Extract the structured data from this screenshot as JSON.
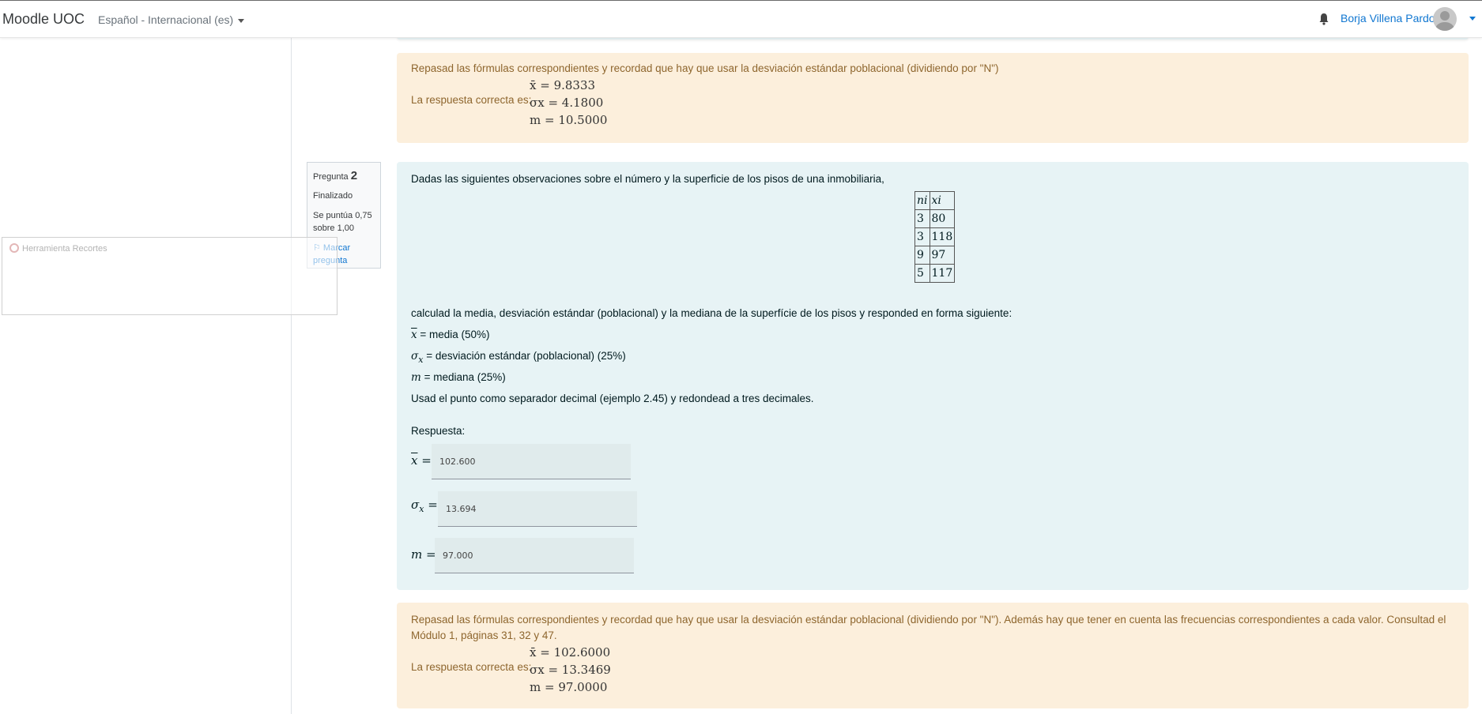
{
  "navbar": {
    "brand": "Moodle UOC",
    "language": "Español - Internacional (es)",
    "notifications_icon": "bell-icon",
    "username": "Borja Villena Pardo",
    "avatar_icon": "user-avatar-icon"
  },
  "snipping_tool": {
    "title": "Herramienta Recortes"
  },
  "feedback_prev": {
    "text": "Repasad las fórmulas correspondientes y recordad que hay que usar la desviación estándar poblacional (dividiendo por \"N\")",
    "correct_label": "La respuesta correcta es:",
    "mean": "x̄ = 9.8333",
    "sd": "σx = 4.1800",
    "median": "m = 10.5000"
  },
  "question_info": {
    "label": "Pregunta",
    "number": "2",
    "state": "Finalizado",
    "grade": "Se puntúa 0,75 sobre 1,00",
    "flag": "Marcar pregunta",
    "flag_icon": "flag-icon"
  },
  "question": {
    "intro": "Dadas las siguientes observaciones sobre el número y la superficie de los pisos de una inmobiliaria,",
    "table_headers": [
      "ni",
      "xi"
    ],
    "table_rows": [
      [
        "3",
        "80"
      ],
      [
        "3",
        "118"
      ],
      [
        "9",
        "97"
      ],
      [
        "5",
        "117"
      ]
    ],
    "instruction": "calculad la media, desviación estándar (poblacional) y la mediana de la superfície de los pisos y responded en forma siguiente:",
    "mean_desc": "= media (50%)",
    "sd_desc": "= desviación estándar (poblacional) (25%)",
    "median_desc": "= mediana (25%)",
    "decimal_note": "Usad el punto como separador decimal (ejemplo 2.45) y redondead a tres decimales.",
    "answer_label": "Respuesta:",
    "answers": {
      "mean_value": "102.600",
      "sd_value": "13.694",
      "median_value": "97.000"
    }
  },
  "feedback_q2": {
    "text": "Repasad las fórmulas correspondientes y recordad que hay que usar la desviación estándar poblacional (dividiendo por \"N\"). Además hay que tener en cuenta las frecuencias correspondientes a cada valor. Consultad el Módulo 1, páginas 31, 32 y 47.",
    "correct_label": "La respuesta correcta es:",
    "mean": "x̄ = 102.6000",
    "sd": "σx = 13.3469",
    "median": "m = 97.0000"
  }
}
